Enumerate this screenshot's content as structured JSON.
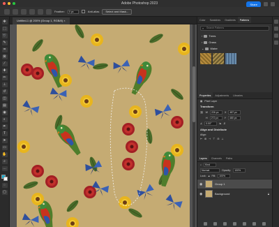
{
  "app": {
    "title": "Adobe Photoshop 2023"
  },
  "document": {
    "tab_label": "Untitled-1 @ 200% (Group 1, RGB/8)"
  },
  "options_bar": {
    "feather_label": "Feather:",
    "feather_value": "0 px",
    "antialias_label": "Anti-alias",
    "select_mask_label": "Select and Mask...",
    "share_label": "Share"
  },
  "colors": {
    "canvas_bg": "#c5ab73",
    "accent": "#1473e6",
    "panel_bg": "#323232"
  },
  "top_panel": {
    "tabs": [
      "Color",
      "Swatches",
      "Gradients",
      "Patterns"
    ],
    "active_tab": "Patterns",
    "search_placeholder": "Search Patterns",
    "groups": [
      "Trees",
      "Grass",
      "Water"
    ]
  },
  "properties_panel": {
    "tabs": [
      "Properties",
      "Adjustments",
      "Libraries"
    ],
    "layer_type": "Pixel Layer",
    "transform_title": "Transform",
    "w": "226 px",
    "x": "487 px",
    "h": "272 px",
    "y": "480 px",
    "angle": "0.00°",
    "align_title": "Align and Distribute",
    "align_label": "Align:"
  },
  "layers_panel": {
    "tabs": [
      "Layers",
      "Channels",
      "Paths"
    ],
    "kind_label": "Kind",
    "blend_mode": "Normal",
    "opacity_label": "Opacity:",
    "opacity_value": "100%",
    "lock_label": "Lock:",
    "fill_label": "Fill:",
    "fill_value": "100%",
    "layers": [
      {
        "name": "Group 1",
        "selected": true
      },
      {
        "name": "Background",
        "selected": false
      }
    ]
  }
}
